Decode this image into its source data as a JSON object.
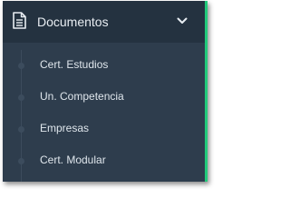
{
  "menu": {
    "title": "Documentos",
    "icon": "document-icon",
    "expand_icon": "chevron-down-icon",
    "accent_color": "#21c97a",
    "items": [
      {
        "label": "Cert. Estudios"
      },
      {
        "label": "Un. Competencia"
      },
      {
        "label": "Empresas"
      },
      {
        "label": "Cert. Modular"
      }
    ]
  }
}
